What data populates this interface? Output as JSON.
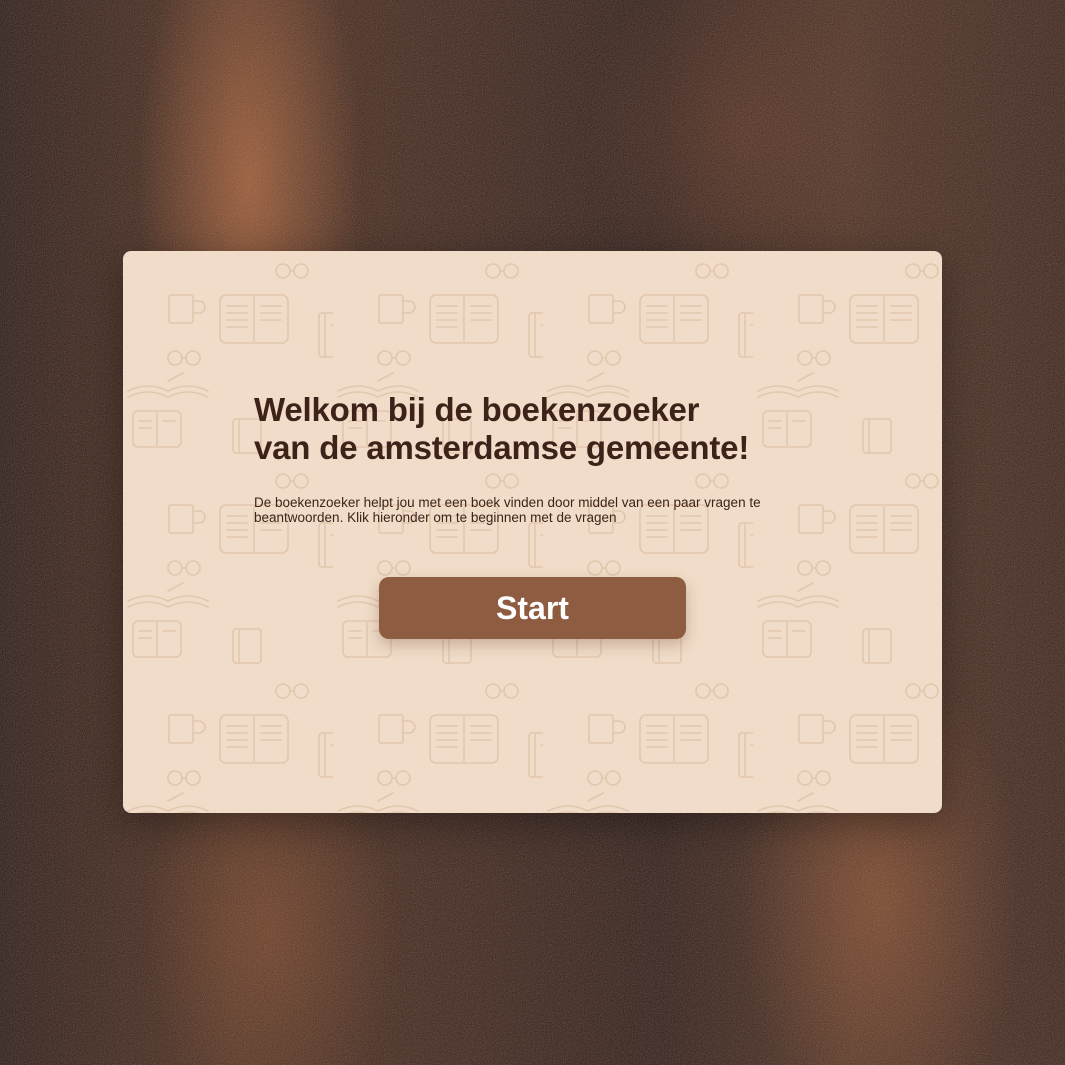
{
  "welcome": {
    "title_line1": "Welkom bij de boekenzoeker",
    "title_line2": "van de amsterdamse gemeente!",
    "description": "De boekenzoeker helpt jou met een boek vinden door middel van een paar vragen te beantwoorden. Klik hieronder om te beginnen met de vragen",
    "start_label": "Start"
  },
  "colors": {
    "card_background": "#f0dcc8",
    "text": "#3d2219",
    "button": "#8e5c40",
    "button_text": "#ffffff",
    "page_background": "#3a2016"
  },
  "icons": [
    "open-book-icon",
    "closed-book-icon",
    "notebook-icon",
    "mug-icon",
    "glasses-icon"
  ]
}
